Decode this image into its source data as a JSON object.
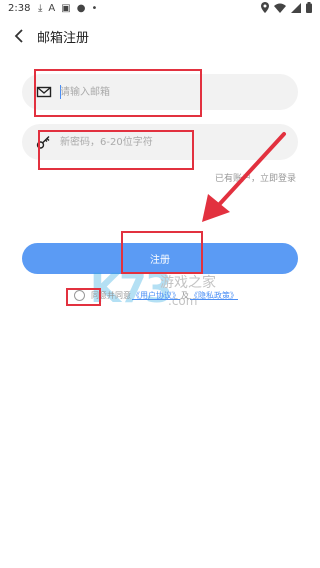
{
  "status_bar": {
    "time": "2:38",
    "left_icons": [
      "download-icon",
      "text-icon",
      "image-icon",
      "ca-icon",
      "dot-icon"
    ],
    "right_icons": [
      "location-icon",
      "wifi-icon",
      "signal-icon",
      "battery-icon"
    ]
  },
  "header": {
    "title": "邮箱注册",
    "back_icon": "chevron-left-icon"
  },
  "form": {
    "email_placeholder": "请输入邮箱",
    "email_icon": "mail-icon",
    "password_placeholder": "新密码，6-20位字符",
    "password_icon": "key-icon"
  },
  "login_link": "已有账户，立即登录",
  "register_button": "注册",
  "agreement": {
    "prefix": "同意并同意",
    "user_agreement": "《用户协议》",
    "conjunction": "及",
    "privacy_policy": "《隐私政策》"
  },
  "watermark": {
    "letters": "K73",
    "text": "游戏之家",
    "domain": ".com"
  },
  "colors": {
    "accent": "#5b9bf4",
    "annotation": "#e2313f",
    "field_bg": "#f2f2f2"
  }
}
